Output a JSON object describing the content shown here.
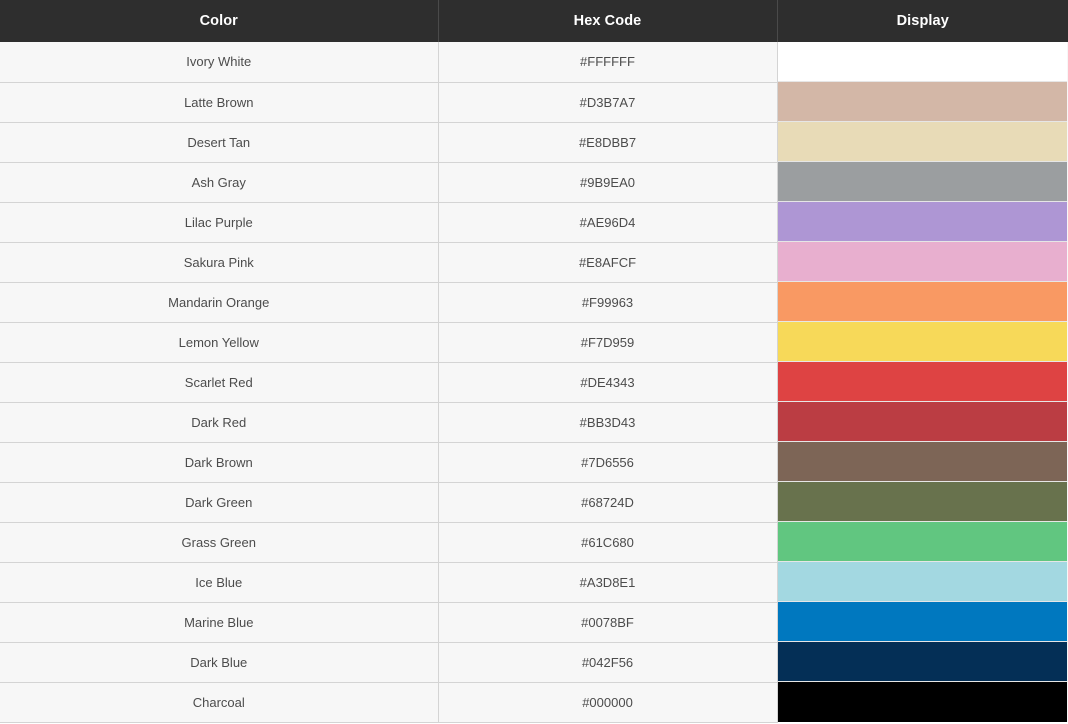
{
  "table": {
    "columns": [
      {
        "key": "name",
        "label": "Color"
      },
      {
        "key": "hex",
        "label": "Hex Code"
      },
      {
        "key": "display",
        "label": "Display"
      }
    ],
    "header_background": "#2e2e2e",
    "header_text_color": "#FFFFFF",
    "row_background": "#f7f7f7",
    "row_border_color": "#d4d4d4",
    "rows": [
      {
        "name": "Ivory White",
        "hex": "#FFFFFF"
      },
      {
        "name": "Latte Brown",
        "hex": "#D3B7A7"
      },
      {
        "name": "Desert Tan",
        "hex": "#E8DBB7"
      },
      {
        "name": "Ash Gray",
        "hex": "#9B9EA0"
      },
      {
        "name": "Lilac Purple",
        "hex": "#AE96D4"
      },
      {
        "name": "Sakura Pink",
        "hex": "#E8AFCF"
      },
      {
        "name": "Mandarin Orange",
        "hex": "#F99963"
      },
      {
        "name": "Lemon Yellow",
        "hex": "#F7D959"
      },
      {
        "name": "Scarlet Red",
        "hex": "#DE4343"
      },
      {
        "name": "Dark Red",
        "hex": "#BB3D43"
      },
      {
        "name": "Dark Brown",
        "hex": "#7D6556"
      },
      {
        "name": "Dark Green",
        "hex": "#68724D"
      },
      {
        "name": "Grass Green",
        "hex": "#61C680"
      },
      {
        "name": "Ice Blue",
        "hex": "#A3D8E1"
      },
      {
        "name": "Marine Blue",
        "hex": "#0078BF"
      },
      {
        "name": "Dark Blue",
        "hex": "#042F56"
      },
      {
        "name": "Charcoal",
        "hex": "#000000"
      }
    ]
  }
}
